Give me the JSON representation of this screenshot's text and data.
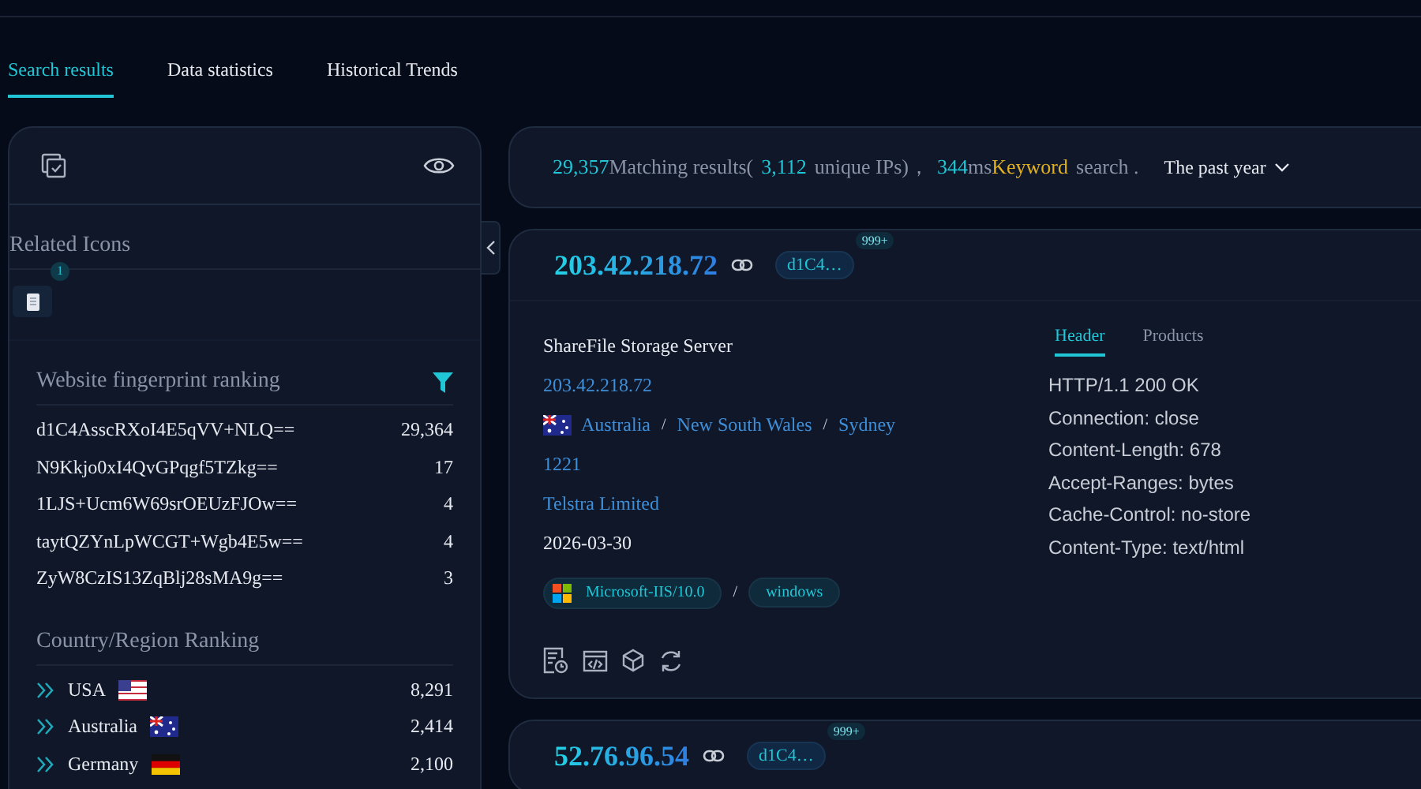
{
  "tabs": [
    {
      "label": "Search results",
      "selected": true
    },
    {
      "label": "Data statistics",
      "selected": false
    },
    {
      "label": "Historical Trends",
      "selected": false
    }
  ],
  "sidebar": {
    "related_icons": {
      "title": "Related Icons",
      "items": [
        {
          "badge": "1"
        }
      ]
    },
    "fingerprint_ranking": {
      "title": "Website fingerprint ranking",
      "rows": [
        {
          "label": "d1C4AsscRXoI4E5qVV+NLQ==",
          "count": "29,364"
        },
        {
          "label": "N9Kkjo0xI4QvGPqgf5TZkg==",
          "count": "17"
        },
        {
          "label": "1LJS+Ucm6W69srOEUzFJOw==",
          "count": "4"
        },
        {
          "label": "taytQZYnLpWCGT+Wgb4E5w==",
          "count": "4"
        },
        {
          "label": "ZyW8CzIS13ZqBlj28sMA9g==",
          "count": "3"
        }
      ]
    },
    "country_ranking": {
      "title": "Country/Region Ranking",
      "rows": [
        {
          "name": "USA",
          "kind": "us",
          "count": "8,291"
        },
        {
          "name": "Australia",
          "kind": "au",
          "count": "2,414"
        },
        {
          "name": "Germany",
          "kind": "de",
          "count": "2,100"
        }
      ]
    }
  },
  "summary": {
    "total": "29,357",
    "total_label": "Matching results(",
    "unique": "3,112",
    "unique_label": "unique IPs)，",
    "time": "344",
    "time_unit": "ms",
    "mode": "Keyword",
    "mode_label": "search .",
    "range": "The past year"
  },
  "results": [
    {
      "ip": "203.42.218.72",
      "tag": "d1C4…",
      "tag_count": "999+",
      "title": "ShareFile Storage Server",
      "ip_link": "203.42.218.72",
      "location": {
        "kind": "au",
        "separator": "/",
        "parts": [
          "Australia",
          "New South Wales",
          "Sydney"
        ]
      },
      "asn": "1221",
      "org": "Telstra Limited",
      "date": "2026-03-30",
      "product_separator": "/",
      "products": [
        {
          "name": "Microsoft-IIS/10.0",
          "kind": "microsoft"
        },
        {
          "name": "windows",
          "kind": "plain"
        }
      ],
      "detail_tabs": [
        {
          "label": "Header",
          "selected": true
        },
        {
          "label": "Products",
          "selected": false
        }
      ],
      "header_lines": [
        "HTTP/1.1 200 OK",
        "Connection: close",
        "Content-Length: 678",
        "Accept-Ranges: bytes",
        "Cache-Control: no-store",
        "Content-Type: text/html"
      ]
    },
    {
      "ip": "52.76.96.54",
      "tag": "d1C4…",
      "tag_count": "999+"
    }
  ]
}
